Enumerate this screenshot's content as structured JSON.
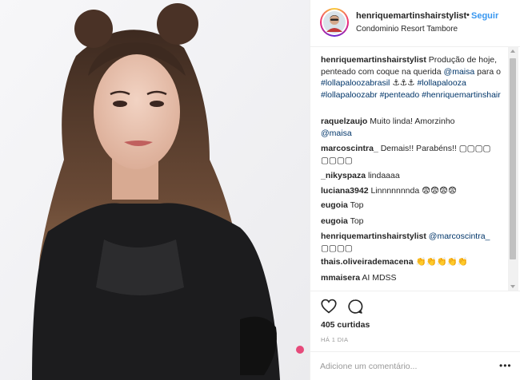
{
  "post": {
    "username": "henriquemartinshairstylist",
    "separator": "•",
    "follow_label": "Seguir",
    "location": "Condominio Resort Tambore",
    "avatar_icon": "avatar-photo-icon",
    "photo_icon": "post-photo-icon"
  },
  "caption": {
    "user": "henriquemartinshairstylist",
    "text_1": "Produção de hoje, penteado com coque na querida",
    "mention_maisa": "@maisa",
    "text_2": "para o",
    "tag_lollapaloozabrasil": "#lollapaloozabrasil",
    "anchors": "⚓⚓⚓",
    "tag_lollapalooza": "#lollapalooza",
    "tag_lollapaloozabr": "#lollapaloozabr",
    "tag_penteado": "#penteado",
    "tag_henriquemartinshair": "#henriquemartinshair"
  },
  "comments": [
    {
      "user": "raquelzaujo",
      "text": "Muito linda! Amorzinho",
      "mention": "@maisa"
    },
    {
      "user": "marcoscintra_",
      "text": "Demais!! Parabéns!! ▢▢▢▢",
      "wrap": "▢▢▢▢"
    },
    {
      "user": "_nikyspaza",
      "text": "lindaaaa"
    },
    {
      "user": "luciana3942",
      "text": "Linnnnnnnda 😨😨😨😨"
    },
    {
      "user": "eugoia",
      "text": "Top"
    },
    {
      "user": "eugoia",
      "text": "Top"
    },
    {
      "user": "henriquemartinshairstylist",
      "mention": "@marcoscintra_",
      "wrap": "▢▢▢▢"
    },
    {
      "user": "thais.oliveirademacena",
      "text": "👏👏👏👏👏"
    },
    {
      "user": "mmaisera",
      "text": "AI MDSS"
    }
  ],
  "actions": {
    "like_icon": "heart-icon",
    "comment_icon": "comment-bubble-icon",
    "likes_label": "405 curtidas",
    "timestamp": "HÁ 1 DIA"
  },
  "add_comment": {
    "placeholder": "Adicione um comentário...",
    "more_icon": "more-options-icon",
    "more_glyph": "•••"
  },
  "colors": {
    "link": "#003569",
    "follow": "#3897f0",
    "text": "#262626",
    "muted": "#999999",
    "border": "#efefef"
  }
}
